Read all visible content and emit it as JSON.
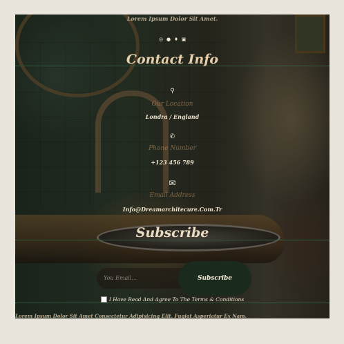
{
  "header": {
    "tagline": "Lorem Ipsum Dolor Sit Amet.",
    "social_icons": [
      "instagram-icon",
      "facebook-icon",
      "twitter-icon",
      "linkedin-icon"
    ]
  },
  "contact": {
    "title": "Contact Info",
    "location": {
      "icon": "map-pin-icon",
      "label": "Our Location",
      "value": "Londra / England"
    },
    "phone": {
      "icon": "phone-icon",
      "label": "Phone Number",
      "value": "+123 456 789"
    },
    "email": {
      "icon": "envelope-icon",
      "label": "Email Address",
      "value": "Info@Dreamarchitecure.Com.Tr"
    }
  },
  "subscribe": {
    "title": "Subscribe",
    "email_placeholder": "You Email...",
    "button_label": "Subscribe",
    "agree_text": "I Have Read And Agree To The Terms & Conditions"
  },
  "footer": {
    "text": "Lorem Ipsum Dolor Sit Amet Consectetur Adipisicing Elit. Fugiat Asperiatur Ex Nam."
  },
  "colors": {
    "page_bg": "#e9e4dc",
    "button_bg": "#1a2a1d",
    "title_color": "#e6d0ab"
  }
}
